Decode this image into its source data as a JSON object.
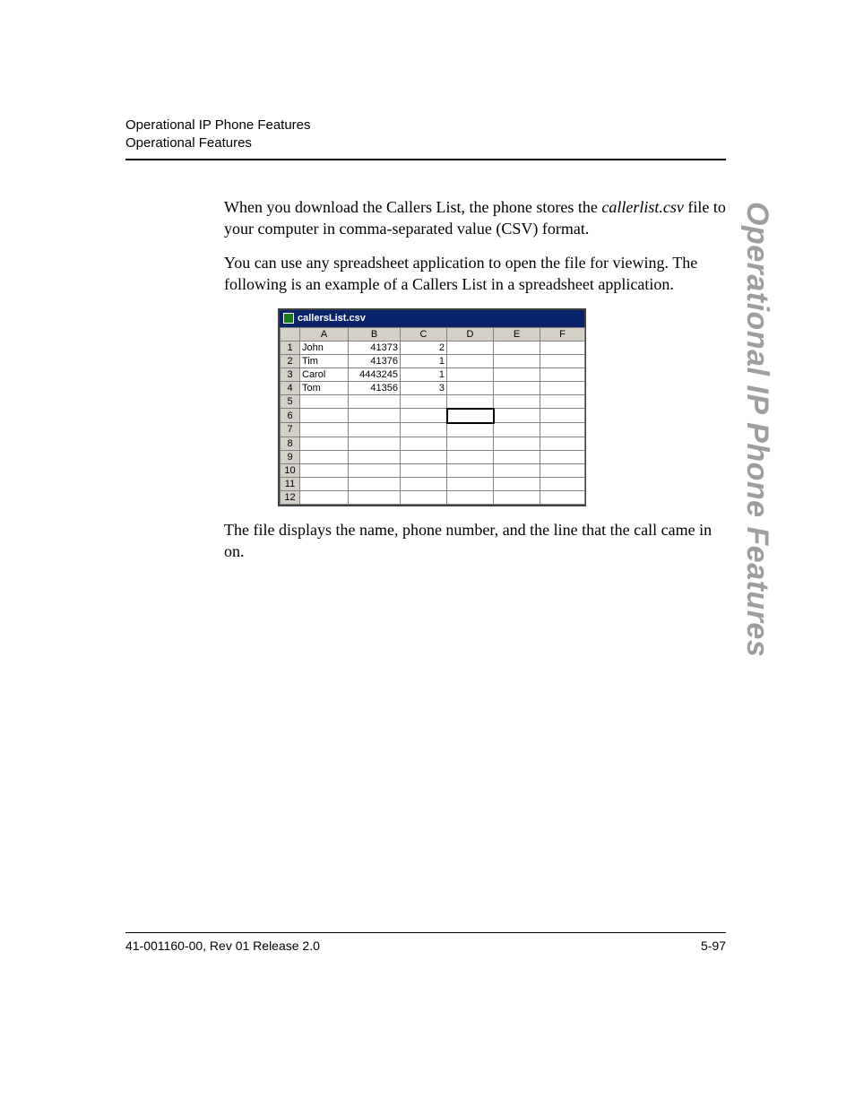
{
  "header": {
    "line1": "Operational IP Phone Features",
    "line2": "Operational Features"
  },
  "body": {
    "p1a": "When you download the Callers List, the phone stores the ",
    "p1_filename": "callerlist.csv",
    "p1b": " file to your computer in comma-separated value (CSV) format.",
    "p2": "You can use any spreadsheet application to open the file for viewing. The following is an example of a Callers List in a spreadsheet application.",
    "p3": "The file displays the name, phone number, and the line that the call came in on."
  },
  "spreadsheet": {
    "filename": "callersList.csv",
    "columns": [
      "A",
      "B",
      "C",
      "D",
      "E",
      "F"
    ],
    "rows": [
      {
        "n": "1",
        "a": "John",
        "b": "41373",
        "c": "2"
      },
      {
        "n": "2",
        "a": "Tim",
        "b": "41376",
        "c": "1"
      },
      {
        "n": "3",
        "a": "Carol",
        "b": "4443245",
        "c": "1"
      },
      {
        "n": "4",
        "a": "Tom",
        "b": "41356",
        "c": "3"
      },
      {
        "n": "5",
        "a": "",
        "b": "",
        "c": ""
      },
      {
        "n": "6",
        "a": "",
        "b": "",
        "c": ""
      },
      {
        "n": "7",
        "a": "",
        "b": "",
        "c": ""
      },
      {
        "n": "8",
        "a": "",
        "b": "",
        "c": ""
      },
      {
        "n": "9",
        "a": "",
        "b": "",
        "c": ""
      },
      {
        "n": "10",
        "a": "",
        "b": "",
        "c": ""
      },
      {
        "n": "11",
        "a": "",
        "b": "",
        "c": ""
      },
      {
        "n": "12",
        "a": "",
        "b": "",
        "c": ""
      }
    ]
  },
  "side_title": "Operational IP Phone Features",
  "footer": {
    "left": "41-001160-00, Rev 01  Release 2.0",
    "right": "5-97"
  }
}
